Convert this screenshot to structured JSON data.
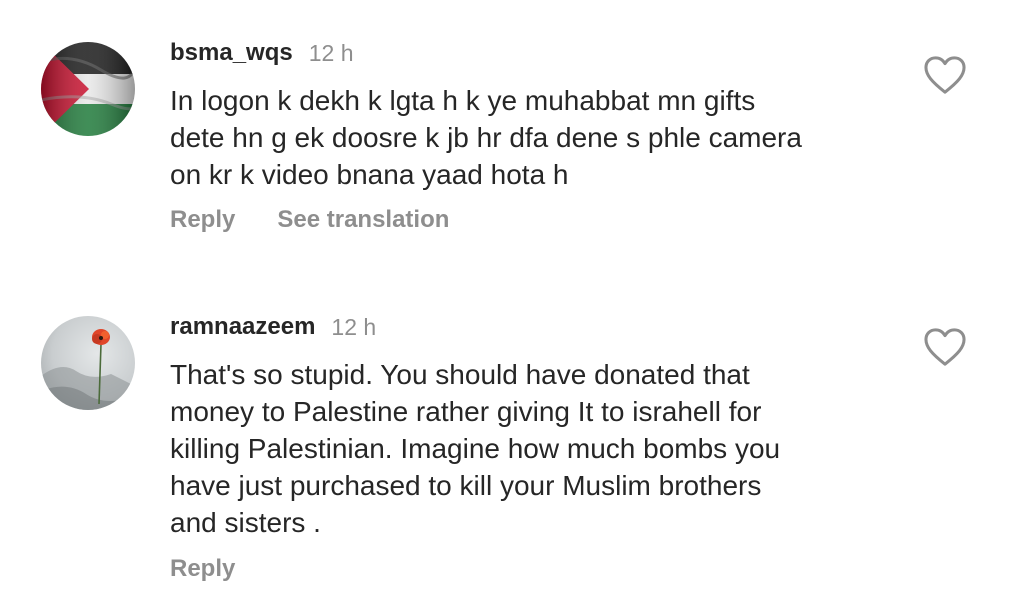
{
  "comments": [
    {
      "username": "bsma_wqs",
      "time": "12 h",
      "text": "In logon k dekh k lgta h k ye muhabbat mn gifts\ndete hn g ek doosre k jb hr dfa dene s phle camera\non kr k video bnana yaad hota h",
      "actions": {
        "reply": "Reply",
        "translate": "See translation"
      },
      "avatar": "palestine-flag-avatar",
      "like_icon": "heart-outline-icon"
    },
    {
      "username": "ramnaazeem",
      "time": "12 h",
      "text": "That's so stupid. You should have donated that\nmoney to Palestine rather giving It to israhell for\nkilling Palestinian.  Imagine how much bombs you\nhave just purchased to kill your Muslim brothers\nand sisters .",
      "actions": {
        "reply": "Reply"
      },
      "avatar": "red-poppy-flower-avatar",
      "like_icon": "heart-outline-icon"
    }
  ],
  "colors": {
    "primary_text": "#262626",
    "secondary_text": "#8e8e8e",
    "background": "#ffffff"
  }
}
